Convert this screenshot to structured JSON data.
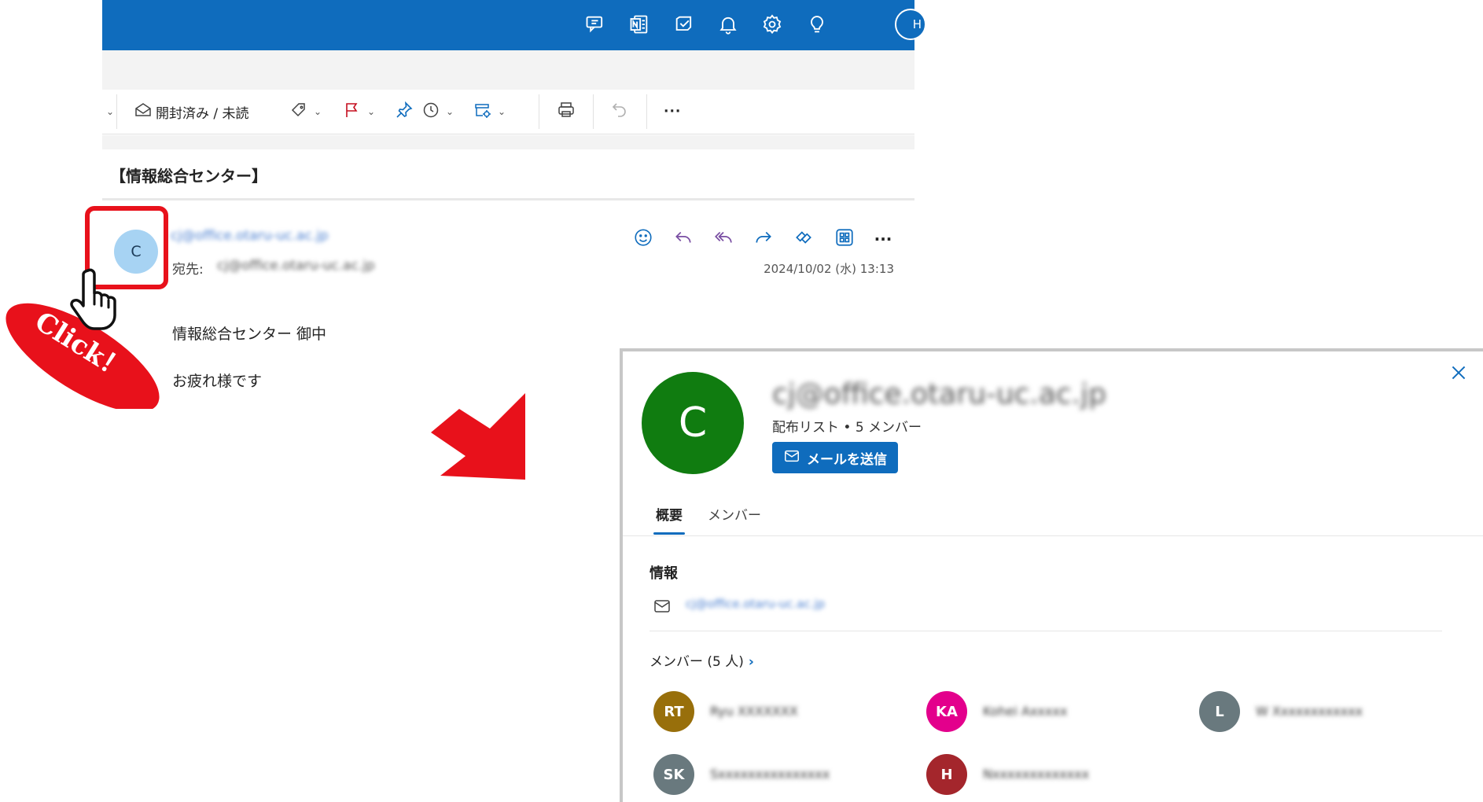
{
  "topbar": {
    "icons": [
      "chat-feedback-icon",
      "onenote-icon",
      "to-do-icon",
      "bell-icon",
      "gear-icon",
      "lightbulb-icon"
    ],
    "avatar_initial": "H"
  },
  "toolbar": {
    "read_unread_label": "開封済み / 未読"
  },
  "email": {
    "subject": "【情報総合センター】",
    "sender_initial": "C",
    "sender_email": "cj@office.otaru-uc.ac.jp",
    "to_label": "宛先:",
    "to_email": "cj@office.otaru-uc.ac.jp",
    "date": "2024/10/02 (水) 13:13",
    "body_line1": "情報総合センター 御中",
    "body_line2": "お疲れ様です"
  },
  "callout": {
    "click_text": "Click！"
  },
  "card": {
    "avatar_initial": "C",
    "name": "cj@office.otaru-uc.ac.jp",
    "subtitle": "配布リスト • 5 メンバー",
    "send_mail_label": "メールを送信",
    "tabs": [
      "概要",
      "メンバー"
    ],
    "info_heading": "情報",
    "info_email": "cj@office.otaru-uc.ac.jp",
    "members_heading": "メンバー (5 人)",
    "members": [
      {
        "initials": "RT",
        "color": "#986f0b",
        "name": "Ryu XXXXXXX"
      },
      {
        "initials": "KA",
        "color": "#e3008c",
        "name": "Kohei Axxxxx"
      },
      {
        "initials": "L",
        "color": "#69797e",
        "name": "W Xxxxxxxxxxxx"
      },
      {
        "initials": "SK",
        "color": "#69797e",
        "name": "Sxxxxxxxxxxxxxxx"
      },
      {
        "initials": "H",
        "color": "#a4262c",
        "name": "Nxxxxxxxxxxxxx"
      }
    ]
  },
  "colors": {
    "brand_blue": "#0f6cbd",
    "callout_red": "#e8111b",
    "card_avatar_green": "#107c10"
  }
}
